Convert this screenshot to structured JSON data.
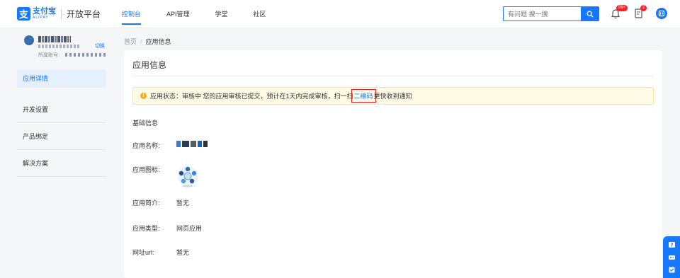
{
  "header": {
    "logo_cn": "支付宝",
    "logo_en": "ALIPAY",
    "platform": "开放平台",
    "nav": [
      "控制台",
      "API管理",
      "学堂",
      "社区"
    ],
    "search_placeholder": "有问题 搜一搜",
    "notification_badge": "99+",
    "todo_badge": "2"
  },
  "sidebar": {
    "switch_label": "切换",
    "account_label": "所属账号:",
    "menu": [
      "应用详情",
      "开发设置",
      "产品绑定",
      "解决方案"
    ]
  },
  "breadcrumb": {
    "home": "首页",
    "separator": "/",
    "current": "应用信息"
  },
  "card": {
    "title": "应用信息",
    "alert": {
      "prefix": "应用状态：审核中 您的应用审核已提交，预计在1天内完成审核，扫一扫",
      "link": "二维码",
      "suffix": "更快收到通知"
    },
    "section_title": "基础信息",
    "fields": {
      "name_label": "应用名称:",
      "icon_label": "应用图标:",
      "intro_label": "应用简介:",
      "intro_value": "暂无",
      "type_label": "应用类型:",
      "type_value": "网页应用",
      "url_label": "网址url:",
      "url_value": "暂无"
    }
  },
  "colors": {
    "brand": "#1677ff",
    "warning": "#faad14",
    "alert_bg": "#fffbe6",
    "highlight_box": "#e02020",
    "badge": "#f5222d"
  }
}
